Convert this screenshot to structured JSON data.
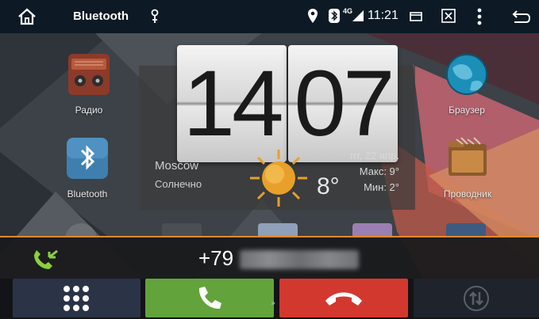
{
  "statusbar": {
    "title": "Bluetooth",
    "network": "4G",
    "time": "11:21"
  },
  "apps": [
    {
      "label": "Радио",
      "icon": "radio-icon"
    },
    {
      "label": "Браузер",
      "icon": "browser-icon"
    },
    {
      "label": "Bluetooth",
      "icon": "bluetooth-app-icon"
    },
    {
      "label": "Проводник",
      "icon": "file-manager-icon"
    }
  ],
  "clock": {
    "hours": "14",
    "minutes": "07"
  },
  "weather": {
    "city": "Moscow",
    "condition": "Солнечно",
    "temperature": "8°",
    "date": "пт, 22 апр.",
    "max": "Макс:   9°",
    "min": "Мин:   2°"
  },
  "call": {
    "number": "+79"
  },
  "colors": {
    "statusbar": "#0d1a26",
    "accent": "#e08a2a",
    "answer": "#63a33b",
    "reject": "#d3382f",
    "keypad": "#2b3346"
  }
}
